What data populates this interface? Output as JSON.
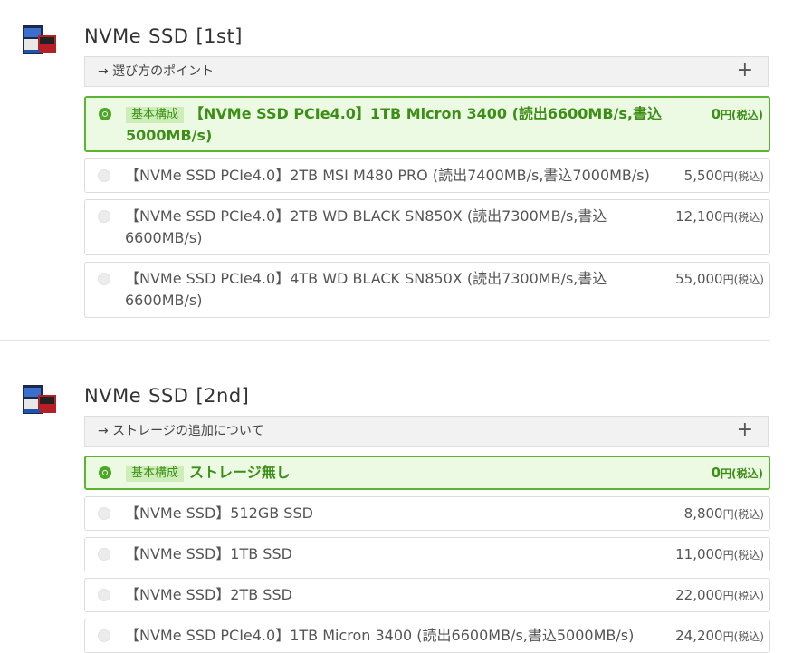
{
  "sections": [
    {
      "title": "NVMe SSD [1st]",
      "title_main": "NVMe",
      "title_mid": "SSD",
      "title_tag": "[1st]",
      "point_label": "→ 選び方のポイント",
      "point_expand": "+",
      "options": [
        {
          "badge": "基本構成",
          "label_line1": "【NVMe SSD PCIe4.0】1TB Micron 3400 (読出6600MB/s,書込",
          "label_line2": "5000MB/s)",
          "price": "0",
          "price_unit": "円",
          "tax": "(税込)",
          "selected": true
        },
        {
          "label_line1": "【NVMe SSD PCIe4.0】2TB MSI M480 PRO (読出7400MB/s,書込7000MB/s)",
          "label_line2": "",
          "price": "5,500",
          "price_unit": "円",
          "tax": "(税込)"
        },
        {
          "label_line1": "【NVMe SSD PCIe4.0】2TB WD BLACK SN850X (読出7300MB/s,書込",
          "label_line2": "6600MB/s)",
          "price": "12,100",
          "price_unit": "円",
          "tax": "(税込)"
        },
        {
          "label_line1": "【NVMe SSD PCIe4.0】4TB WD BLACK SN850X (読出7300MB/s,書込",
          "label_line2": "6600MB/s)",
          "price": "55,000",
          "price_unit": "円",
          "tax": "(税込)"
        }
      ]
    },
    {
      "title": "NVMe SSD [2nd]",
      "title_main": "NVMe",
      "title_mid": "SSD",
      "title_tag": "[2nd]",
      "point_label": "→ ストレージの追加について",
      "point_expand": "+",
      "options": [
        {
          "badge": "基本構成",
          "label_line1": "ストレージ無し",
          "price": "0",
          "price_unit": "円",
          "tax": "(税込)",
          "selected": true
        },
        {
          "label_line1": "【NVMe SSD】512GB SSD",
          "price": "8,800",
          "price_unit": "円",
          "tax": "(税込)"
        },
        {
          "label_line1": "【NVMe SSD】1TB SSD",
          "price": "11,000",
          "price_unit": "円",
          "tax": "(税込)"
        },
        {
          "label_line1": "【NVMe SSD】2TB SSD",
          "price": "22,000",
          "price_unit": "円",
          "tax": "(税込)"
        },
        {
          "label_line1": "【NVMe SSD PCIe4.0】1TB Micron 3400 (読出6600MB/s,書込5000MB/s)",
          "price": "24,200",
          "price_unit": "円",
          "tax": "(税込)"
        }
      ]
    }
  ],
  "colors": {
    "accent_green": "#4aa825",
    "selected_bg": "#ecfae3",
    "badge_bg": "#cdeeb8"
  }
}
